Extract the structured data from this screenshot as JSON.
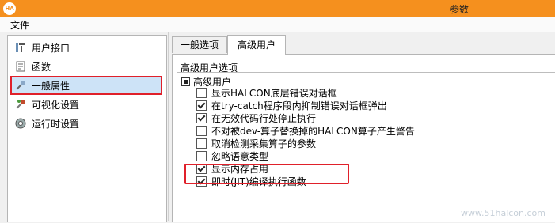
{
  "window": {
    "title": "参数",
    "app_icon": "halcon-logo-icon",
    "accent": "#f5901e"
  },
  "menu": {
    "file": "文件"
  },
  "sidebar": {
    "items": [
      {
        "label": "用户接口",
        "icon": "user-interface-icon",
        "selected": false
      },
      {
        "label": "函数",
        "icon": "function-icon",
        "selected": false
      },
      {
        "label": "一般属性",
        "icon": "general-properties-icon",
        "selected": true
      },
      {
        "label": "可视化设置",
        "icon": "visualization-icon",
        "selected": false
      },
      {
        "label": "运行时设置",
        "icon": "runtime-icon",
        "selected": false
      }
    ]
  },
  "tabs": [
    {
      "label": "一般选项",
      "active": false
    },
    {
      "label": "高级用户",
      "active": true
    }
  ],
  "content": {
    "group_title": "高级用户选项",
    "section_title": "高级用户",
    "options": [
      {
        "label": "显示HALCON底层错误对话框",
        "checked": false
      },
      {
        "label": "在try-catch程序段内抑制错误对话框弹出",
        "checked": true
      },
      {
        "label": "在无效代码行处停止执行",
        "checked": true
      },
      {
        "label": "不对被dev-算子替换掉的HALCON算子产生警告",
        "checked": false
      },
      {
        "label": "取消检测采集算子的参数",
        "checked": false
      },
      {
        "label": "忽略语意类型",
        "checked": false
      },
      {
        "label": "显示内存占用",
        "checked": true
      },
      {
        "label": "即时(JIT)编译执行函数",
        "checked": true
      }
    ]
  },
  "watermark": "www.51halcon.com",
  "highlight_color": "#e0202a"
}
